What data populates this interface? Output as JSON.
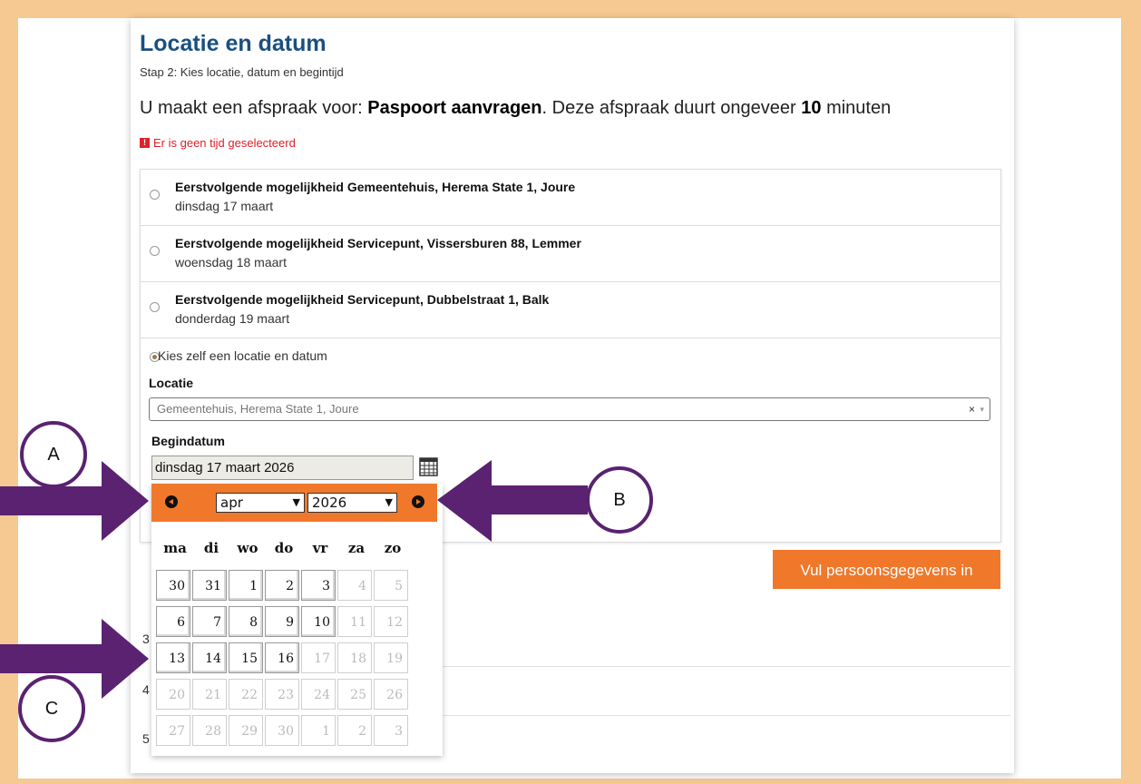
{
  "header": {
    "title": "Locatie en datum",
    "step": "Stap 2: Kies locatie, datum en begintijd",
    "intro_pre": "U maakt een afspraak voor: ",
    "intro_service": "Paspoort aanvragen",
    "intro_mid": ". Deze afspraak duurt ongeveer ",
    "intro_duration": "10",
    "intro_post": " minuten"
  },
  "error": {
    "icon": "!",
    "text": "Er is geen tijd geselecteerd"
  },
  "options": [
    {
      "title": "Eerstvolgende mogelijkheid Gemeentehuis, Herema State 1, Joure",
      "date": "dinsdag 17 maart"
    },
    {
      "title": "Eerstvolgende mogelijkheid Servicepunt, Vissersburen 88, Lemmer",
      "date": "woensdag 18 maart"
    },
    {
      "title": "Eerstvolgende mogelijkheid Servicepunt, Dubbelstraat 1, Balk",
      "date": "donderdag 19 maart"
    }
  ],
  "own_choice": {
    "label": "Kies zelf een locatie en datum",
    "location_label": "Locatie",
    "location_value": "Gemeentehuis, Herema State 1, Joure",
    "location_clear": "×",
    "start_label": "Begindatum",
    "start_value": "dinsdag 17 maart 2026"
  },
  "next_button": "Vul persoonsgegevens in",
  "row_numbers": [
    "3",
    "4",
    "5"
  ],
  "datepicker": {
    "month": "apr",
    "year": "2026",
    "weekdays": [
      "ma",
      "di",
      "wo",
      "do",
      "vr",
      "za",
      "zo"
    ],
    "weeks": [
      [
        {
          "d": "30",
          "a": true
        },
        {
          "d": "31",
          "a": true
        },
        {
          "d": "1",
          "a": true
        },
        {
          "d": "2",
          "a": true
        },
        {
          "d": "3",
          "a": true
        },
        {
          "d": "4",
          "a": false
        },
        {
          "d": "5",
          "a": false
        }
      ],
      [
        {
          "d": "6",
          "a": true
        },
        {
          "d": "7",
          "a": true
        },
        {
          "d": "8",
          "a": true
        },
        {
          "d": "9",
          "a": true
        },
        {
          "d": "10",
          "a": true
        },
        {
          "d": "11",
          "a": false
        },
        {
          "d": "12",
          "a": false
        }
      ],
      [
        {
          "d": "13",
          "a": true
        },
        {
          "d": "14",
          "a": true
        },
        {
          "d": "15",
          "a": true
        },
        {
          "d": "16",
          "a": true
        },
        {
          "d": "17",
          "a": false
        },
        {
          "d": "18",
          "a": false
        },
        {
          "d": "19",
          "a": false
        }
      ],
      [
        {
          "d": "20",
          "a": false
        },
        {
          "d": "21",
          "a": false
        },
        {
          "d": "22",
          "a": false
        },
        {
          "d": "23",
          "a": false
        },
        {
          "d": "24",
          "a": false
        },
        {
          "d": "25",
          "a": false
        },
        {
          "d": "26",
          "a": false
        }
      ],
      [
        {
          "d": "27",
          "a": false
        },
        {
          "d": "28",
          "a": false
        },
        {
          "d": "29",
          "a": false
        },
        {
          "d": "30",
          "a": false
        },
        {
          "d": "1",
          "a": false
        },
        {
          "d": "2",
          "a": false
        },
        {
          "d": "3",
          "a": false
        }
      ]
    ]
  },
  "annotations": {
    "a": "A",
    "b": "B",
    "c": "C"
  },
  "colors": {
    "frame": "#f6c892",
    "accent": "#f0782a",
    "title": "#1a4f80",
    "error": "#e0202a",
    "arrow": "#5a2271"
  }
}
